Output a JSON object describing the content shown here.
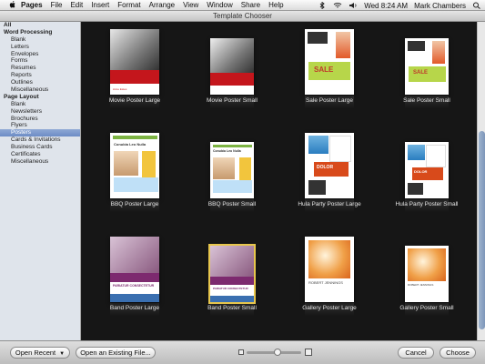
{
  "menubar": {
    "app": "Pages",
    "items": [
      "File",
      "Edit",
      "Insert",
      "Format",
      "Arrange",
      "View",
      "Window",
      "Share",
      "Help"
    ],
    "clock": "Wed 8:24 AM",
    "user": "Mark Chambers"
  },
  "window": {
    "title": "Template Chooser"
  },
  "sidebar": {
    "rows": [
      {
        "label": "All",
        "level": "header"
      },
      {
        "label": "Word Processing",
        "level": "header"
      },
      {
        "label": "Blank",
        "level": "item"
      },
      {
        "label": "Letters",
        "level": "item"
      },
      {
        "label": "Envelopes",
        "level": "item"
      },
      {
        "label": "Forms",
        "level": "item"
      },
      {
        "label": "Resumes",
        "level": "item"
      },
      {
        "label": "Reports",
        "level": "item"
      },
      {
        "label": "Outlines",
        "level": "item"
      },
      {
        "label": "Miscellaneous",
        "level": "item"
      },
      {
        "label": "Page Layout",
        "level": "header"
      },
      {
        "label": "Blank",
        "level": "item"
      },
      {
        "label": "Newsletters",
        "level": "item"
      },
      {
        "label": "Brochures",
        "level": "item"
      },
      {
        "label": "Flyers",
        "level": "item"
      },
      {
        "label": "Posters",
        "level": "item",
        "selected": true
      },
      {
        "label": "Cards & Invitations",
        "level": "item"
      },
      {
        "label": "Business Cards",
        "level": "item"
      },
      {
        "label": "Certificates",
        "level": "item"
      },
      {
        "label": "Miscellaneous",
        "level": "item"
      }
    ]
  },
  "templates": [
    {
      "label": "Movie Poster Large",
      "text": [
        "Anne Estes"
      ]
    },
    {
      "label": "Movie Poster Small",
      "text": []
    },
    {
      "label": "Sale Poster Large",
      "text": [
        "SALE"
      ]
    },
    {
      "label": "Sale Poster Small",
      "text": [
        "SALE"
      ]
    },
    {
      "label": "BBQ Poster Large",
      "text": [
        "Conubia Leo Nulla"
      ]
    },
    {
      "label": "BBQ Poster Small",
      "text": [
        "Conubia Leo Nulla"
      ]
    },
    {
      "label": "Hula Party Poster Large",
      "text": [
        "DOLOR"
      ]
    },
    {
      "label": "Hula Party Poster Small",
      "text": [
        "DOLOR"
      ]
    },
    {
      "label": "Band Poster Large",
      "text": [
        "PARIATUR CONSECTETUR"
      ]
    },
    {
      "label": "Band Poster Small",
      "text": [
        "PARIATUR CONSECTETUR"
      ],
      "selected": true
    },
    {
      "label": "Gallery Poster Large",
      "text": [
        "ROBERT JENNINGS"
      ]
    },
    {
      "label": "Gallery Poster Small",
      "text": [
        "ROBERT JENNINGS"
      ]
    }
  ],
  "bottombar": {
    "open_recent": "Open Recent",
    "open_existing": "Open an Existing File...",
    "cancel": "Cancel",
    "choose": "Choose"
  },
  "colors": {
    "selection": "#6d8cc6",
    "thumb_selected": "#e7c64c",
    "background": "#161616"
  }
}
